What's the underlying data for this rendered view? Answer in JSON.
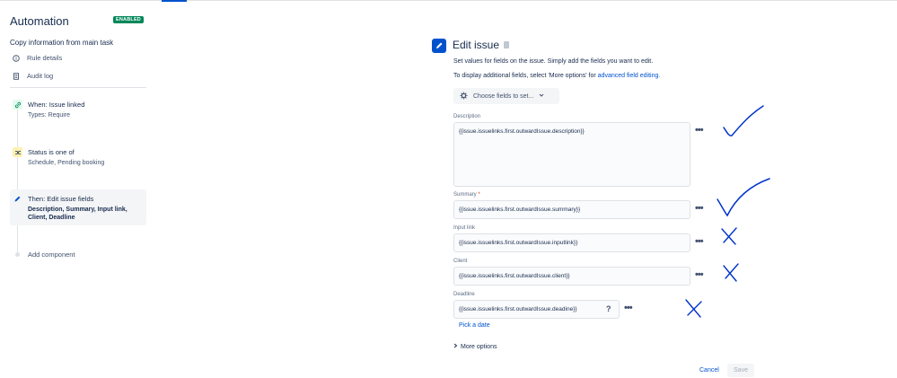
{
  "sidebar": {
    "app_title": "Automation",
    "status_badge": "ENABLED",
    "rule_name": "Copy information from main task",
    "menu": [
      {
        "label": "Rule details",
        "icon": "info-icon"
      },
      {
        "label": "Audit log",
        "icon": "log-icon"
      }
    ],
    "steps": [
      {
        "title": "When: Issue linked",
        "subtitle": "Types: Require",
        "icon": "link-icon",
        "color": "#00875a"
      },
      {
        "title": "Status is one of",
        "subtitle": "Schedule, Pending booking",
        "icon": "shuffle-icon",
        "color": "#ff991f"
      },
      {
        "title": "Then: Edit issue fields",
        "subtitle_line1": "Description, Summary, Input link,",
        "subtitle_line2": "Client, Deadline",
        "icon": "pencil-icon",
        "color": "#0052cc"
      }
    ],
    "add_component": "Add component"
  },
  "panel": {
    "title": "Edit issue",
    "description_text": "Set values for fields on the issue. Simply add the fields you want to edit.",
    "more_info_prefix": "To display additional fields, select 'More options' for ",
    "more_info_link": "advanced field editing.",
    "choose_fields": "Choose fields to set...",
    "fields": {
      "description": {
        "label": "Description",
        "value": "{{issue.issuelinks.first.outwardIssue.description}}"
      },
      "summary": {
        "label": "Summary",
        "required": "*",
        "value": "{{issue.issuelinks.first.outwardIssue.summary}}"
      },
      "input_link": {
        "label": "Input link",
        "value": "{{issue.issuelinks.first.outwardIssue.inputlink}}"
      },
      "client": {
        "label": "Client",
        "value": "{{issue.issuelinks.first.outwardIssue.client}}"
      },
      "deadline": {
        "label": "Deadline",
        "value": "{{issue.issuelinks.first.outwardIssue.deadine}}",
        "help": "?"
      }
    },
    "more_dots": "•••",
    "pick_date": "Pick a date",
    "more_options": "More options",
    "cancel": "Cancel",
    "save": "Save"
  },
  "colors": {
    "accent": "#0052cc",
    "enabled": "#00875a",
    "annotation_ink": "#0033cc"
  }
}
